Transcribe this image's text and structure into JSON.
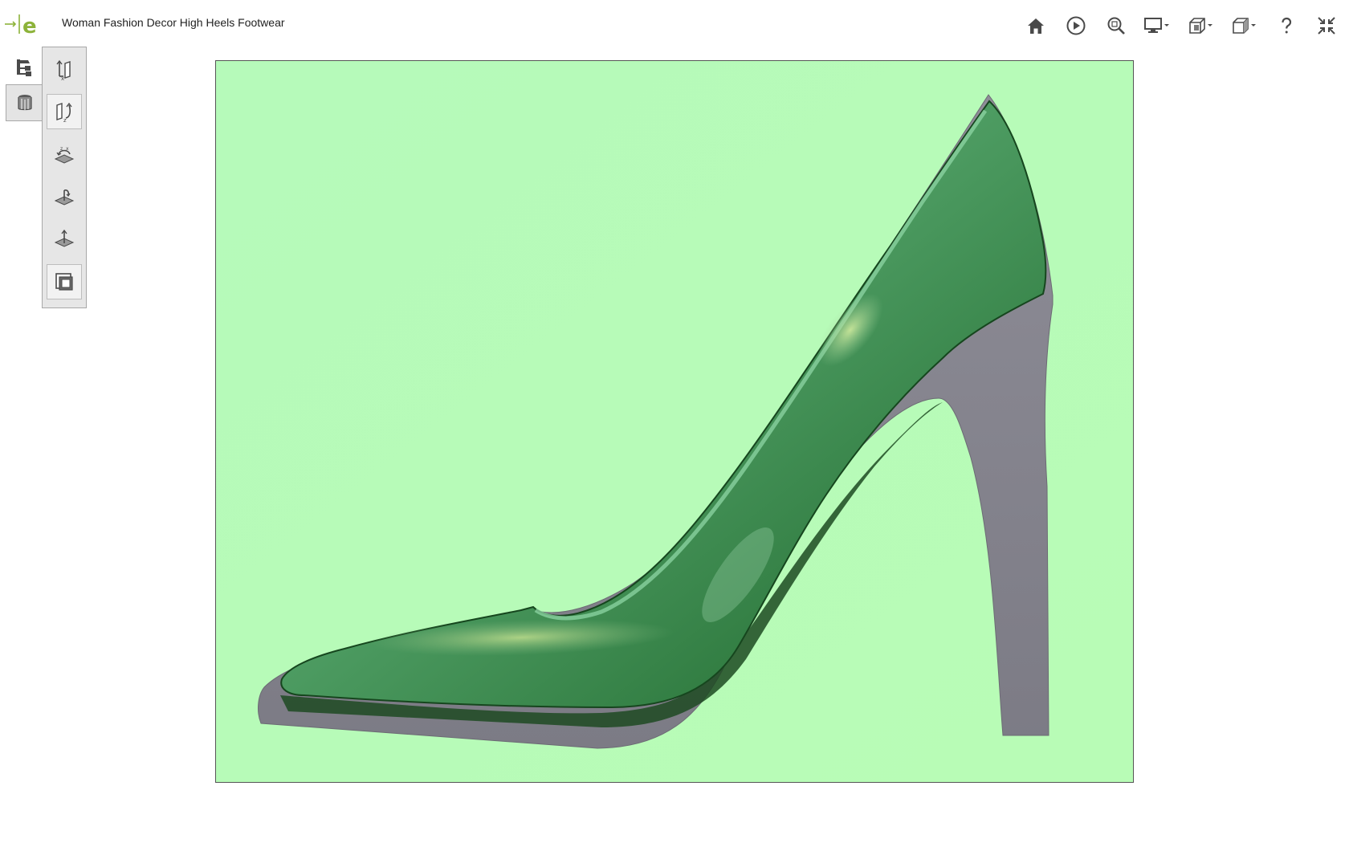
{
  "window": {
    "title": "Woman Fashion Decor High Heels Footwear",
    "logo": {
      "name": "edrawings-logo",
      "brand_color": "#8db33a"
    }
  },
  "toolbar": {
    "buttons": [
      {
        "name": "home-button",
        "icon": "home-icon",
        "has_dropdown": false
      },
      {
        "name": "play-button",
        "icon": "play-circle-icon",
        "has_dropdown": false
      },
      {
        "name": "zoom-to-fit-button",
        "icon": "zoom-fit-icon",
        "has_dropdown": false
      },
      {
        "name": "display-style-button",
        "icon": "monitor-icon",
        "has_dropdown": true
      },
      {
        "name": "section-view-button",
        "icon": "section-cube-icon",
        "has_dropdown": true
      },
      {
        "name": "standard-views-button",
        "icon": "view-cube-icon",
        "has_dropdown": true
      },
      {
        "name": "help-button",
        "icon": "question-icon",
        "has_dropdown": false
      },
      {
        "name": "fullscreen-button",
        "icon": "collapse-arrows-icon",
        "has_dropdown": false
      }
    ]
  },
  "left_panel": {
    "tabs": [
      {
        "name": "component-tree-tab",
        "icon": "tree-icon",
        "active": false
      },
      {
        "name": "configurations-tab",
        "icon": "configurations-icon",
        "active": true
      }
    ],
    "tools": [
      {
        "name": "rotate-x-tool",
        "icon": "rotate-axis-x-icon",
        "active": false
      },
      {
        "name": "rotate-z-tool",
        "icon": "rotate-axis-z-icon",
        "active": true
      },
      {
        "name": "rotate-plane-tool",
        "icon": "rotate-plane-icon",
        "active": false
      },
      {
        "name": "tilt-plane-tool",
        "icon": "tilt-plane-icon",
        "active": false
      },
      {
        "name": "move-up-tool",
        "icon": "plane-arrow-up-icon",
        "active": false
      },
      {
        "name": "layers-tool",
        "icon": "layers-icon",
        "active": true
      }
    ]
  },
  "viewport": {
    "model": "high-heel-shoe",
    "background_color": "#b8fbb8",
    "shoe_body_color": "#4c9a5e",
    "shoe_sole_color": "#86858e"
  }
}
